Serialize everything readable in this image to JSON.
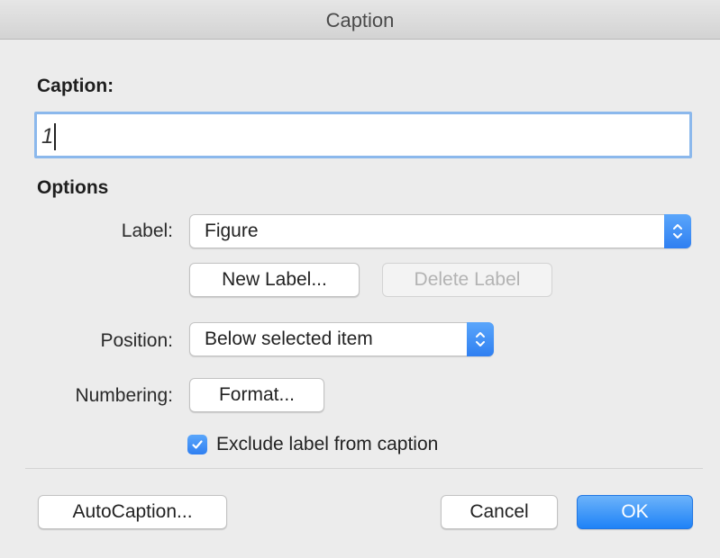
{
  "window": {
    "title": "Caption"
  },
  "caption": {
    "heading": "Caption:",
    "value": "1"
  },
  "options": {
    "heading": "Options",
    "label": {
      "text": "Label:",
      "selected": "Figure"
    },
    "new_label_button": "New Label...",
    "delete_label_button": "Delete Label",
    "position": {
      "text": "Position:",
      "selected": "Below selected item"
    },
    "numbering": {
      "text": "Numbering:",
      "format_button": "Format..."
    },
    "exclude_label": {
      "text": "Exclude label from caption",
      "checked": true
    }
  },
  "footer": {
    "autocaption_button": "AutoCaption...",
    "cancel_button": "Cancel",
    "ok_button": "OK"
  },
  "colors": {
    "accent": "#2f7ff1",
    "focus_ring": "#8bb8ec"
  }
}
